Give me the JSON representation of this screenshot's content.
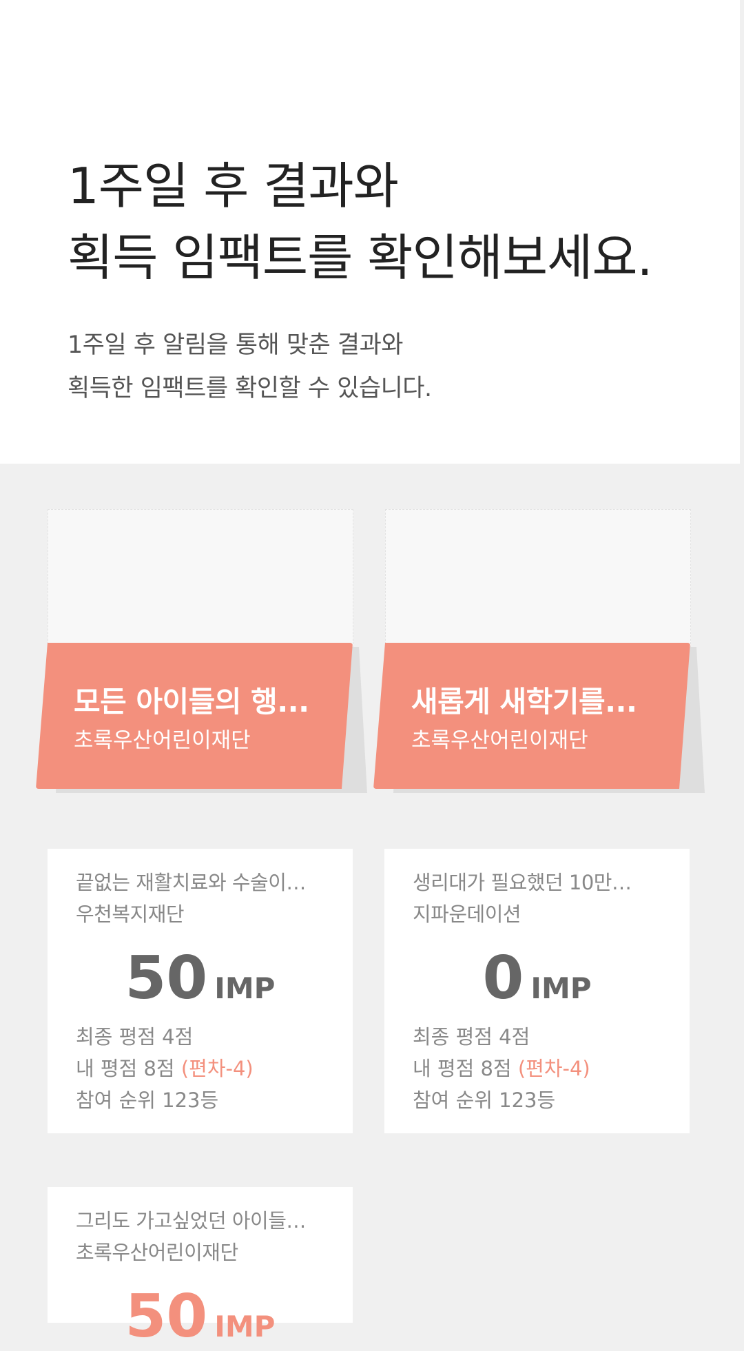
{
  "hero": {
    "title_line1": "1주일 후 결과와",
    "title_line2": "획득 임팩트를 확인해보세요.",
    "desc_line1": "1주일 후 알림을 통해 맞춘 결과와",
    "desc_line2": "획득한 임팩트를 확인할 수 있습니다."
  },
  "preview_cards": [
    {
      "title": "모든 아이들의 행...",
      "org": "초록우산어린이재단"
    },
    {
      "title": "새롭게 새학기를...",
      "org": "초록우산어린이재단"
    }
  ],
  "result_cards": [
    {
      "title": "끝없는 재활치료와 수술이…",
      "org": "우천복지재단",
      "score": "50",
      "unit": "IMP",
      "final_rating": "최종 평점 4점",
      "my_rating": "내 평점 8점",
      "deviation": "(편차-4)",
      "rank": "참여 순위 123등"
    },
    {
      "title": "생리대가 필요했던 10만…",
      "org": "지파운데이션",
      "score": "0",
      "unit": "IMP",
      "final_rating": "최종 평점 4점",
      "my_rating": "내 평점 8점",
      "deviation": "(편차-4)",
      "rank": "참여 순위 123등"
    },
    {
      "title": "그리도 가고싶었던 아이들…",
      "org": "초록우산어린이재단",
      "score": "50",
      "unit": "IMP"
    }
  ],
  "colors": {
    "accent": "#f3907d",
    "background": "#f0f0f0",
    "card": "#ffffff"
  }
}
